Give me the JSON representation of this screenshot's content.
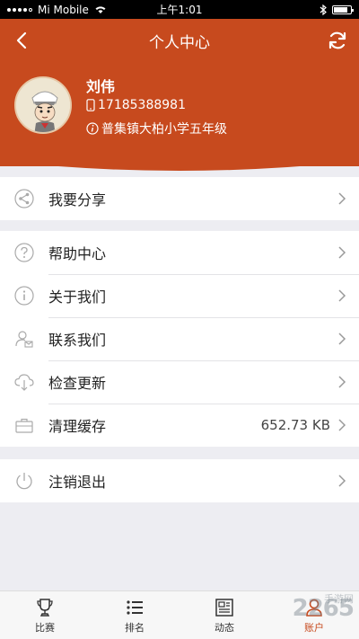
{
  "status_bar": {
    "carrier": "Mi Mobile",
    "time": "上午1:01",
    "battery_level": 0.85
  },
  "header": {
    "title": "个人中心",
    "back_icon": "chevron-left-icon",
    "refresh_icon": "refresh-icon",
    "user": {
      "name": "刘伟",
      "phone": "17185388981",
      "school": "普集镇大柏小学五年级"
    }
  },
  "menu": {
    "share": {
      "label": "我要分享",
      "icon": "share-icon"
    },
    "help": {
      "label": "帮助中心",
      "icon": "help-icon"
    },
    "about": {
      "label": "关于我们",
      "icon": "info-icon"
    },
    "contact": {
      "label": "联系我们",
      "icon": "contact-icon"
    },
    "update": {
      "label": "检查更新",
      "icon": "cloud-download-icon"
    },
    "cache": {
      "label": "清理缓存",
      "value": "652.73 KB",
      "icon": "briefcase-icon"
    },
    "logout": {
      "label": "注销退出",
      "icon": "power-icon"
    }
  },
  "tabbar": {
    "tabs": [
      {
        "label": "比赛",
        "icon": "trophy-icon"
      },
      {
        "label": "排名",
        "icon": "list-icon"
      },
      {
        "label": "动态",
        "icon": "news-icon"
      },
      {
        "label": "账户",
        "icon": "user-icon",
        "active": true
      }
    ]
  },
  "colors": {
    "accent": "#c74a1e",
    "background": "#ededf2"
  },
  "watermark": {
    "text": "2265",
    "sub": "手游网"
  }
}
